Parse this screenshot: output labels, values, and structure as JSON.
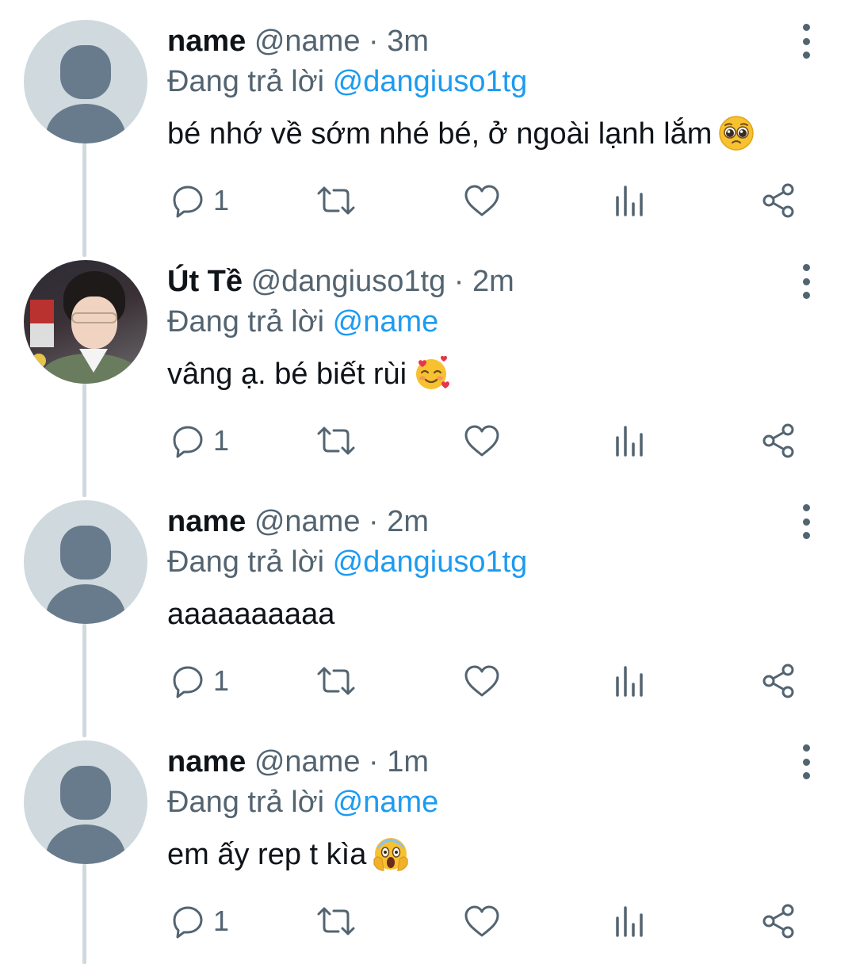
{
  "colors": {
    "text": "#0f1419",
    "muted": "#536471",
    "link": "#1d9bf0",
    "thread_line": "#cfd9de",
    "default_avatar_bg": "#cfd9de",
    "default_avatar_fg": "#687b8c"
  },
  "icons": {
    "reply": "reply-icon",
    "retweet": "retweet-icon",
    "like": "heart-icon",
    "views": "views-chart-icon",
    "share": "share-icon",
    "more": "more-vertical-icon"
  },
  "tweets": [
    {
      "display_name": "name",
      "handle": "@name",
      "separator": "·",
      "time": "3m",
      "reply_prefix": "Đang trả lời",
      "reply_to": "@dangiuso1tg",
      "text": "bé nhớ về sớm nhé bé, ở ngoài lạnh lắm",
      "emoji": "pleading-face",
      "avatar": "default",
      "reply_count": "1"
    },
    {
      "display_name": "Út Tề",
      "handle": "@dangiuso1tg",
      "separator": "·",
      "time": "2m",
      "reply_prefix": "Đang trả lời",
      "reply_to": "@name",
      "text": "vâng ạ. bé biết rùi",
      "emoji": "smiling-face-with-hearts",
      "avatar": "photo",
      "reply_count": "1"
    },
    {
      "display_name": "name",
      "handle": "@name",
      "separator": "·",
      "time": "2m",
      "reply_prefix": "Đang trả lời",
      "reply_to": "@dangiuso1tg",
      "text": "aaaaaaaaaa",
      "emoji": "",
      "avatar": "default",
      "reply_count": "1"
    },
    {
      "display_name": "name",
      "handle": "@name",
      "separator": "·",
      "time": "1m",
      "reply_prefix": "Đang trả lời",
      "reply_to": "@name",
      "text": "em ấy rep t kìa",
      "emoji": "face-screaming-in-fear",
      "avatar": "default",
      "reply_count": "1"
    }
  ]
}
